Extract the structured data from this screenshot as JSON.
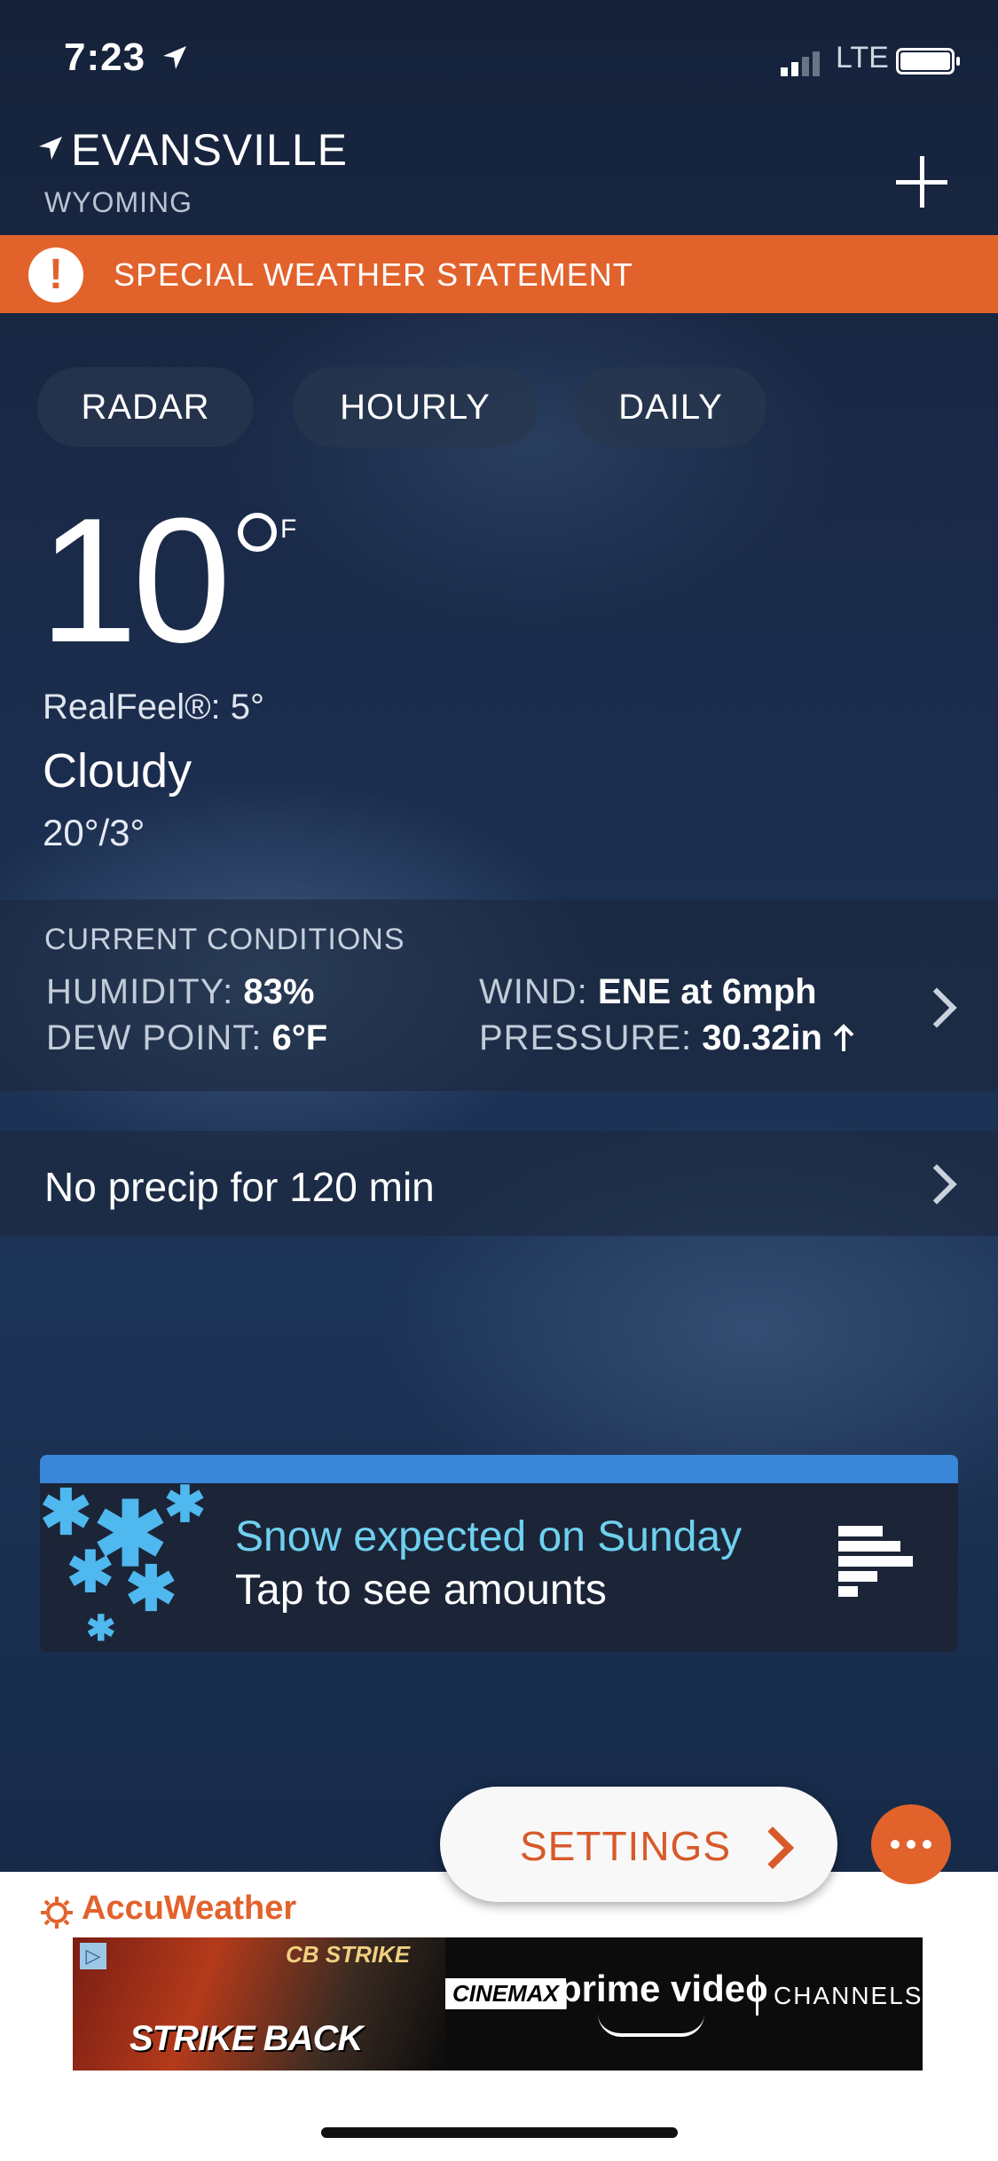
{
  "status_bar": {
    "time": "7:23",
    "network": "LTE"
  },
  "location": {
    "city": "EVANSVILLE",
    "state": "WYOMING"
  },
  "alert": {
    "label": "SPECIAL WEATHER STATEMENT",
    "icon": "!"
  },
  "tabs": [
    {
      "label": "RADAR"
    },
    {
      "label": "HOURLY"
    },
    {
      "label": "DAILY"
    }
  ],
  "current": {
    "temperature": "10",
    "unit": "F",
    "realfeel": "RealFeel®: 5°",
    "condition": "Cloudy",
    "hi_lo": "20°/3°"
  },
  "conditions": {
    "title": "CURRENT CONDITIONS",
    "humidity_label": "HUMIDITY:",
    "humidity_value": "83%",
    "dewpoint_label": "DEW POINT:",
    "dewpoint_value": "6°F",
    "wind_label": "WIND:",
    "wind_value": "ENE at 6mph",
    "pressure_label": "PRESSURE:",
    "pressure_value": "30.32in"
  },
  "precip": {
    "text": "No precip for 120 min"
  },
  "snow_card": {
    "headline": "Snow expected on Sunday",
    "subline": "Tap to see amounts"
  },
  "settings": {
    "label": "SETTINGS"
  },
  "brand": {
    "name": "AccuWeather"
  },
  "ad": {
    "show_title": "STRIKE BACK",
    "series": "CB STRIKE",
    "network": "CINEMAX",
    "service": "prime video",
    "channels": "CHANNELS"
  },
  "colors": {
    "accent": "#e2622c",
    "snow_blue": "#3a86d8",
    "snow_text": "#6fd0ef"
  }
}
